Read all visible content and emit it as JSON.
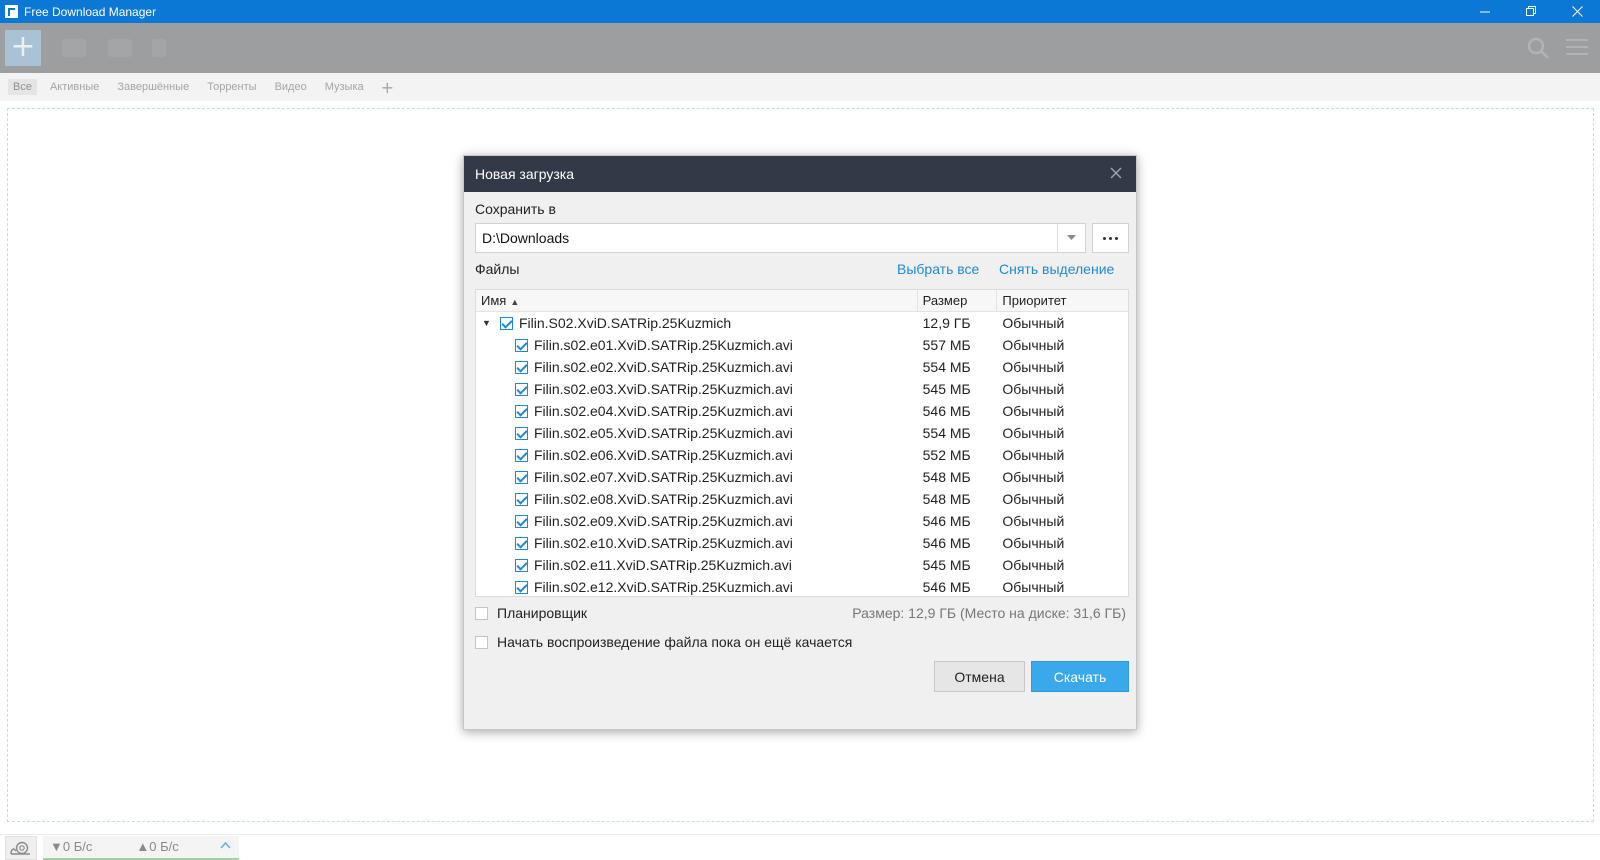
{
  "window": {
    "title": "Free Download Manager",
    "controls": {
      "minimize": "—",
      "restore": "❐",
      "close": "✕"
    }
  },
  "toolbar": {
    "add_icon": "plus-icon",
    "add_symbol": "+"
  },
  "tabs": [
    {
      "label": "Все",
      "active": true
    },
    {
      "label": "Активные",
      "active": false
    },
    {
      "label": "Завершённые",
      "active": false
    },
    {
      "label": "Торренты",
      "active": false
    },
    {
      "label": "Видео",
      "active": false
    },
    {
      "label": "Музыка",
      "active": false
    }
  ],
  "tab_add": "+",
  "dialog": {
    "title": "Новая загрузка",
    "save_to_label": "Сохранить в",
    "save_path": "D:\\Downloads",
    "files_label": "Файлы",
    "select_all": "Выбрать все",
    "deselect": "Снять выделение",
    "columns": {
      "name": "Имя",
      "size": "Размер",
      "priority": "Приоритет"
    },
    "folder": {
      "name": "Filin.S02.XviD.SATRip.25Kuzmich",
      "size": "12,9 ГБ",
      "priority": "Обычный",
      "checked": true,
      "expanded": true
    },
    "files": [
      {
        "name": "Filin.s02.e01.XviD.SATRip.25Kuzmich.avi",
        "size": "557 МБ",
        "priority": "Обычный",
        "checked": true
      },
      {
        "name": "Filin.s02.e02.XviD.SATRip.25Kuzmich.avi",
        "size": "554 МБ",
        "priority": "Обычный",
        "checked": true
      },
      {
        "name": "Filin.s02.e03.XviD.SATRip.25Kuzmich.avi",
        "size": "545 МБ",
        "priority": "Обычный",
        "checked": true
      },
      {
        "name": "Filin.s02.e04.XviD.SATRip.25Kuzmich.avi",
        "size": "546 МБ",
        "priority": "Обычный",
        "checked": true
      },
      {
        "name": "Filin.s02.e05.XviD.SATRip.25Kuzmich.avi",
        "size": "554 МБ",
        "priority": "Обычный",
        "checked": true
      },
      {
        "name": "Filin.s02.e06.XviD.SATRip.25Kuzmich.avi",
        "size": "552 МБ",
        "priority": "Обычный",
        "checked": true
      },
      {
        "name": "Filin.s02.e07.XviD.SATRip.25Kuzmich.avi",
        "size": "548 МБ",
        "priority": "Обычный",
        "checked": true
      },
      {
        "name": "Filin.s02.e08.XviD.SATRip.25Kuzmich.avi",
        "size": "548 МБ",
        "priority": "Обычный",
        "checked": true
      },
      {
        "name": "Filin.s02.e09.XviD.SATRip.25Kuzmich.avi",
        "size": "546 МБ",
        "priority": "Обычный",
        "checked": true
      },
      {
        "name": "Filin.s02.e10.XviD.SATRip.25Kuzmich.avi",
        "size": "546 МБ",
        "priority": "Обычный",
        "checked": true
      },
      {
        "name": "Filin.s02.e11.XviD.SATRip.25Kuzmich.avi",
        "size": "545 МБ",
        "priority": "Обычный",
        "checked": true
      },
      {
        "name": "Filin.s02.e12.XviD.SATRip.25Kuzmich.avi",
        "size": "546 МБ",
        "priority": "Обычный",
        "checked": true
      }
    ],
    "scheduler_label": "Планировщик",
    "scheduler_checked": false,
    "play_while_downloading_label": "Начать воспроизведение файла пока он ещё качается",
    "play_checked": false,
    "size_info": "Размер: 12,9 ГБ (Место на диске: 31,6 ГБ)",
    "cancel_label": "Отмена",
    "download_label": "Скачать"
  },
  "status": {
    "download_speed": "▼0 Б/с",
    "upload_speed": "▲0 Б/с",
    "expand_symbol": "^"
  },
  "colors": {
    "titlebar": "#0a78d4",
    "dialog_header": "#323a48",
    "accent": "#1e8ad6",
    "primary_button": "#3aa9ec"
  }
}
